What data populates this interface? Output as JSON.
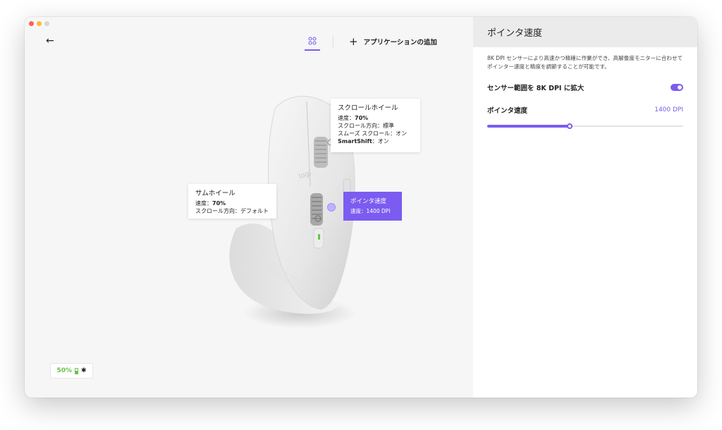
{
  "header": {
    "back_icon": "arrow-left-icon",
    "device_tab_icon": "grid-icon",
    "add_app_icon": "plus-icon",
    "add_app_label": "アプリケーションの追加"
  },
  "callouts": {
    "scroll_wheel": {
      "title": "スクロールホイール",
      "speed_label": "速度：",
      "speed_value": "70%",
      "direction": "スクロール方向：標準",
      "smooth": "スムーズ スクロール：オン",
      "smartshift_label": "SmartShift",
      "smartshift_value": "：オン"
    },
    "thumb_wheel": {
      "title": "サムホイール",
      "speed_label": "速度：",
      "speed_value": "70%",
      "direction": "スクロール方向：デフォルト"
    },
    "pointer_speed": {
      "title": "ポインタ速度",
      "line": "速度：1400 DPI"
    }
  },
  "status": {
    "battery_percent": "50%",
    "battery_icon": "battery-icon",
    "bluetooth_icon": "bluetooth-icon"
  },
  "panel": {
    "title": "ポインタ速度",
    "description": "8K DPI センサーにより高速かつ精確に作業ができ、高解像度モニターに合わせてポインター速度と精度を調節することが可能です。",
    "sensor_label": "センサー範囲を 8K DPI に拡大",
    "sensor_enabled": true,
    "speed_label": "ポインタ速度",
    "speed_value": "1400 DPI",
    "speed_slider_percent": 42
  },
  "colors": {
    "accent": "#7b5cf0",
    "battery": "#6ac14a"
  }
}
